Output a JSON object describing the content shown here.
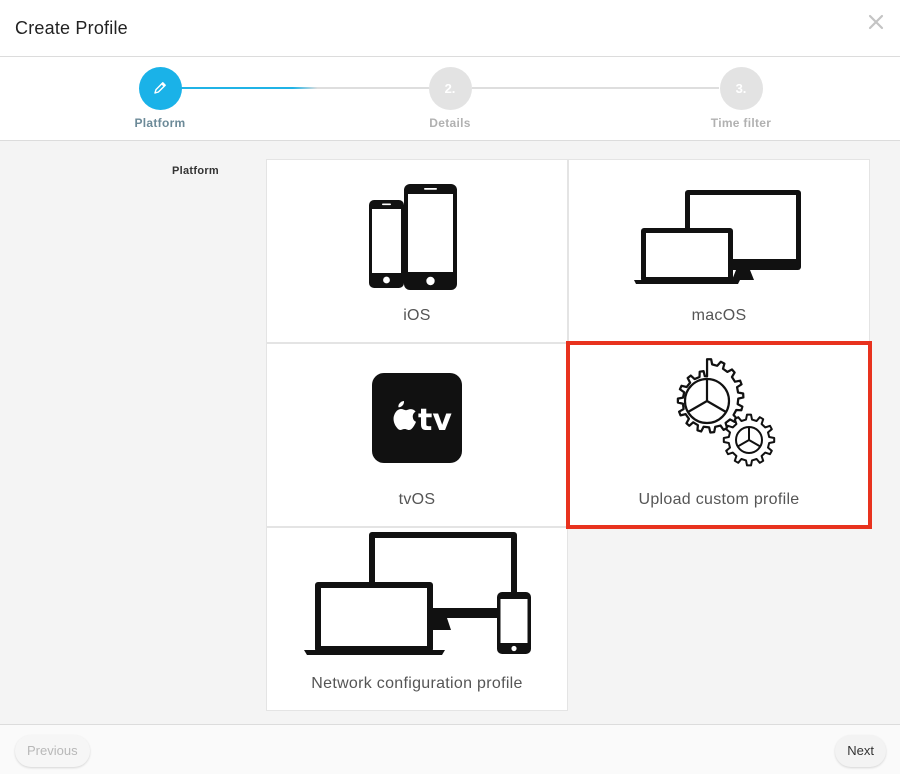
{
  "dialog": {
    "title": "Create Profile",
    "close_icon": "close-icon"
  },
  "stepper": {
    "steps": [
      {
        "number": "",
        "label": "Platform",
        "state": "active",
        "icon": "pencil-icon"
      },
      {
        "number": "2.",
        "label": "Details",
        "state": "pending"
      },
      {
        "number": "3.",
        "label": "Time filter",
        "state": "pending"
      }
    ],
    "active_color": "#1ab2e8"
  },
  "form": {
    "platform_label": "Platform",
    "options": [
      {
        "label": "iOS",
        "icon": "iphone-devices-icon"
      },
      {
        "label": "macOS",
        "icon": "mac-devices-icon"
      },
      {
        "label": "tvOS",
        "icon": "apple-tv-icon"
      },
      {
        "label": "Upload custom profile",
        "icon": "gears-icon",
        "selected": true
      },
      {
        "label": "Network configuration profile",
        "icon": "all-devices-icon"
      }
    ],
    "selection_color": "#e8321e"
  },
  "footer": {
    "previous_label": "Previous",
    "next_label": "Next"
  }
}
